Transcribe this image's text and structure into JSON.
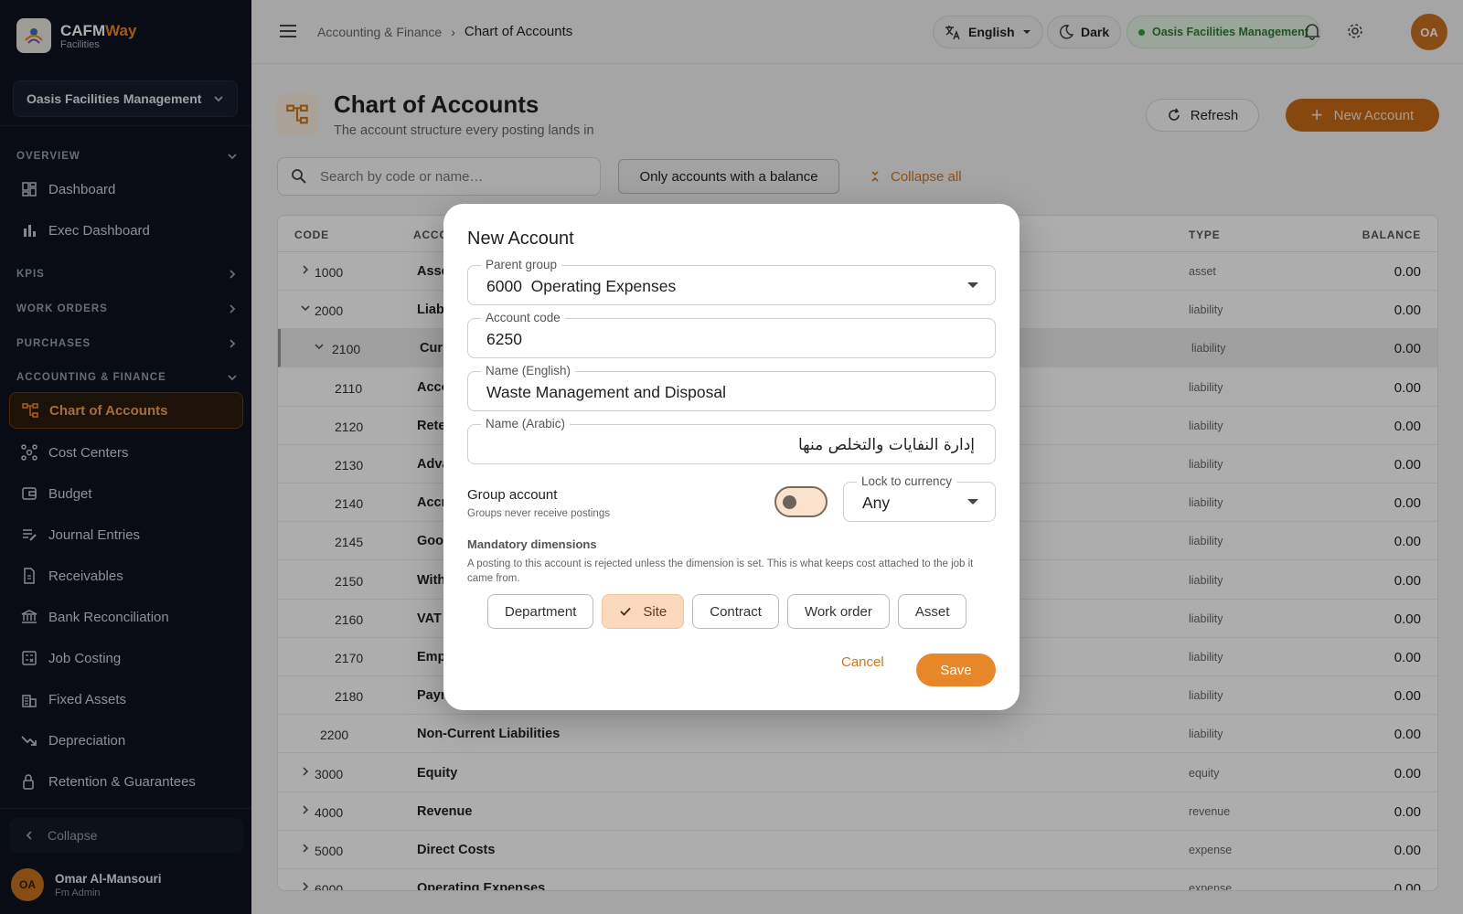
{
  "brand": {
    "name_main": "CAFM",
    "name_accent": "Way",
    "subtitle": "Facilities"
  },
  "org_selector": {
    "label": "Oasis Facilities Management"
  },
  "sidebar": {
    "sections": {
      "overview": "OVERVIEW",
      "kpis": "KPIS",
      "work_orders": "WORK ORDERS",
      "purchases": "PURCHASES",
      "accounting": "ACCOUNTING & FINANCE"
    },
    "overview_items": [
      {
        "label": "Dashboard",
        "icon": "dashboard-icon"
      },
      {
        "label": "Exec Dashboard",
        "icon": "bar-chart-icon"
      }
    ],
    "accounting_items": [
      {
        "label": "Chart of Accounts",
        "icon": "account-tree-icon"
      },
      {
        "label": "Cost Centers",
        "icon": "hub-icon"
      },
      {
        "label": "Budget",
        "icon": "wallet-icon"
      },
      {
        "label": "Journal Entries",
        "icon": "edit-list-icon"
      },
      {
        "label": "Receivables",
        "icon": "receipt-icon"
      },
      {
        "label": "Bank Reconciliation",
        "icon": "bank-icon"
      },
      {
        "label": "Job Costing",
        "icon": "calculator-icon"
      },
      {
        "label": "Fixed Assets",
        "icon": "building-icon"
      },
      {
        "label": "Depreciation",
        "icon": "trending-down-icon"
      },
      {
        "label": "Retention & Guarantees",
        "icon": "lock-icon"
      }
    ],
    "collapse_label": "Collapse",
    "user": {
      "initials": "OA",
      "name": "Omar Al-Mansouri",
      "role": "Fm Admin"
    }
  },
  "header": {
    "breadcrumb_parent": "Accounting & Finance",
    "breadcrumb_current": "Chart of Accounts",
    "language": "English",
    "theme": "Dark",
    "org": "Oasis Facilities Management",
    "avatar_initials": "OA"
  },
  "page": {
    "title": "Chart of Accounts",
    "subtitle": "The account structure every posting lands in",
    "refresh_label": "Refresh",
    "new_account_label": "New Account",
    "search_placeholder": "Search by code or name…",
    "balance_filter_label": "Only accounts with a balance",
    "collapse_all_label": "Collapse all"
  },
  "table": {
    "columns": {
      "code": "CODE",
      "account": "ACCO",
      "type": "TYPE",
      "balance": "BALANCE"
    },
    "rows": [
      {
        "code": "1000",
        "name": "Asse",
        "type": "asset",
        "balance": "0.00",
        "level": 0,
        "chevron": "right"
      },
      {
        "code": "2000",
        "name": "Liab",
        "type": "liability",
        "balance": "0.00",
        "level": 0,
        "chevron": "down"
      },
      {
        "code": "2100",
        "name": "Curr",
        "type": "liability",
        "balance": "0.00",
        "level": 1,
        "chevron": "down"
      },
      {
        "code": "2110",
        "name": "Acco",
        "type": "liability",
        "balance": "0.00",
        "level": 2,
        "chevron": ""
      },
      {
        "code": "2120",
        "name": "Rete",
        "type": "liability",
        "balance": "0.00",
        "level": 2,
        "chevron": ""
      },
      {
        "code": "2130",
        "name": "Adva",
        "type": "liability",
        "balance": "0.00",
        "level": 2,
        "chevron": ""
      },
      {
        "code": "2140",
        "name": "Accr",
        "type": "liability",
        "balance": "0.00",
        "level": 2,
        "chevron": ""
      },
      {
        "code": "2145",
        "name": "Good",
        "type": "liability",
        "balance": "0.00",
        "level": 2,
        "chevron": ""
      },
      {
        "code": "2150",
        "name": "With",
        "type": "liability",
        "balance": "0.00",
        "level": 2,
        "chevron": ""
      },
      {
        "code": "2160",
        "name": "VAT",
        "type": "liability",
        "balance": "0.00",
        "level": 2,
        "chevron": ""
      },
      {
        "code": "2170",
        "name": "Emp",
        "type": "liability",
        "balance": "0.00",
        "level": 2,
        "chevron": ""
      },
      {
        "code": "2180",
        "name": "Payr",
        "type": "liability",
        "balance": "0.00",
        "level": 2,
        "chevron": ""
      },
      {
        "code": "2200",
        "name": "Non-Current Liabilities",
        "type": "liability",
        "balance": "0.00",
        "level": 1,
        "chevron": ""
      },
      {
        "code": "3000",
        "name": "Equity",
        "type": "equity",
        "balance": "0.00",
        "level": 0,
        "chevron": "right"
      },
      {
        "code": "4000",
        "name": "Revenue",
        "type": "revenue",
        "balance": "0.00",
        "level": 0,
        "chevron": "right"
      },
      {
        "code": "5000",
        "name": "Direct Costs",
        "type": "expense",
        "balance": "0.00",
        "level": 0,
        "chevron": "right"
      },
      {
        "code": "6000",
        "name": "Operating Expenses",
        "type": "expense",
        "balance": "0.00",
        "level": 0,
        "chevron": "right"
      }
    ]
  },
  "dialog": {
    "title": "New Account",
    "parent_group": {
      "label": "Parent group",
      "value": "6000  Operating Expenses"
    },
    "account_code": {
      "label": "Account code",
      "value": "6250"
    },
    "name_en": {
      "label": "Name (English)",
      "value": "Waste Management and Disposal"
    },
    "name_ar": {
      "label": "Name (Arabic)",
      "value": "إدارة النفايات والتخلص منها"
    },
    "group_account": {
      "label": "Group account",
      "help": "Groups never receive postings",
      "checked": false
    },
    "currency": {
      "label": "Lock to currency",
      "value": "Any"
    },
    "dimensions": {
      "title": "Mandatory dimensions",
      "help": "A posting to this account is rejected unless the dimension is set. This is what keeps cost attached to the job it came from.",
      "chips": [
        {
          "label": "Department",
          "selected": false
        },
        {
          "label": "Site",
          "selected": true
        },
        {
          "label": "Contract",
          "selected": false
        },
        {
          "label": "Work order",
          "selected": false
        },
        {
          "label": "Asset",
          "selected": false
        }
      ]
    },
    "cancel_label": "Cancel",
    "save_label": "Save"
  },
  "colors": {
    "accent": "#e8862a",
    "sidebar_bg": "#0e1320",
    "success": "#2e7d32"
  }
}
